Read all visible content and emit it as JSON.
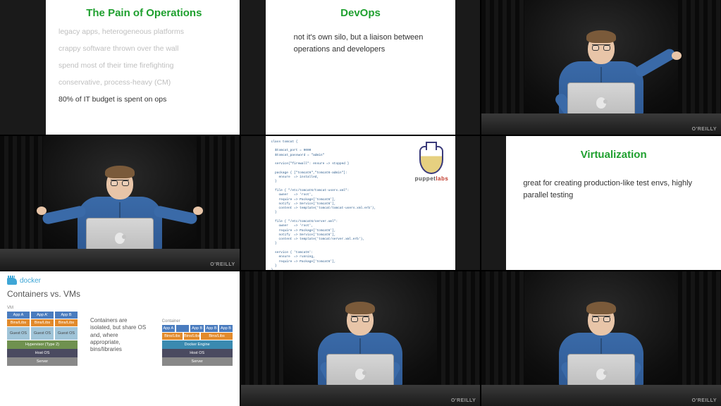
{
  "watermark": "O'REILLY",
  "panel1": {
    "title": "The Pain of Operations",
    "bullets": [
      "legacy apps, heterogeneous platforms",
      "crappy software thrown over the wall",
      "spend most of their time firefighting",
      "conservative, process-heavy (CM)",
      "80% of IT budget is spent on ops"
    ]
  },
  "panel2": {
    "title": "DevOps",
    "body": "not it's own silo, but a liaison between operations and developers"
  },
  "panel5": {
    "brand_a": "puppet",
    "brand_b": "labs",
    "code": "class tomcat {\n\n  $tomcat_port = 9000\n  $tomcat_password = \"admin\"\n\n  service{\"firewall\": ensure => stopped }\n\n  package { [\"tomcat6\",\"tomcat6-admin\"]:\n    ensure  => installed,\n  }\n\n  file { \"/etc/tomcat6/tomcat-users.xml\":\n    owner   => 'root',\n    require => Package['tomcat6'],\n    notify  => Service['tomcat6'],\n    content => template('tomcat/tomcat-users.xml.erb'),\n  }\n\n  file { \"/etc/tomcat6/server.xml\":\n    owner   => 'root',\n    require => Package['tomcat6'],\n    notify  => Service['tomcat6'],\n    content => template('tomcat/server.xml.erb'),\n  }\n\n  service { 'tomcat6':\n    ensure  => running,\n    require => Package['tomcat6'],\n  }\n}"
  },
  "panel6": {
    "title": "Virtualization",
    "body": "great for creating production-like test envs, highly parallel testing"
  },
  "panel7": {
    "brand": "docker",
    "title": "Containers vs. VMs",
    "desc": "Containers are isolated, but share OS and, where appropriate, bins/libraries",
    "labels": {
      "vm": "VM",
      "container": "Container",
      "app_a": "App A",
      "app_a2": "App A'",
      "app_b": "App B",
      "bins": "Bins/Libs",
      "guest": "Guest OS",
      "hypervisor": "Hypervisor (Type 2)",
      "docker": "Docker Engine",
      "host": "Host OS",
      "server": "Server"
    }
  }
}
